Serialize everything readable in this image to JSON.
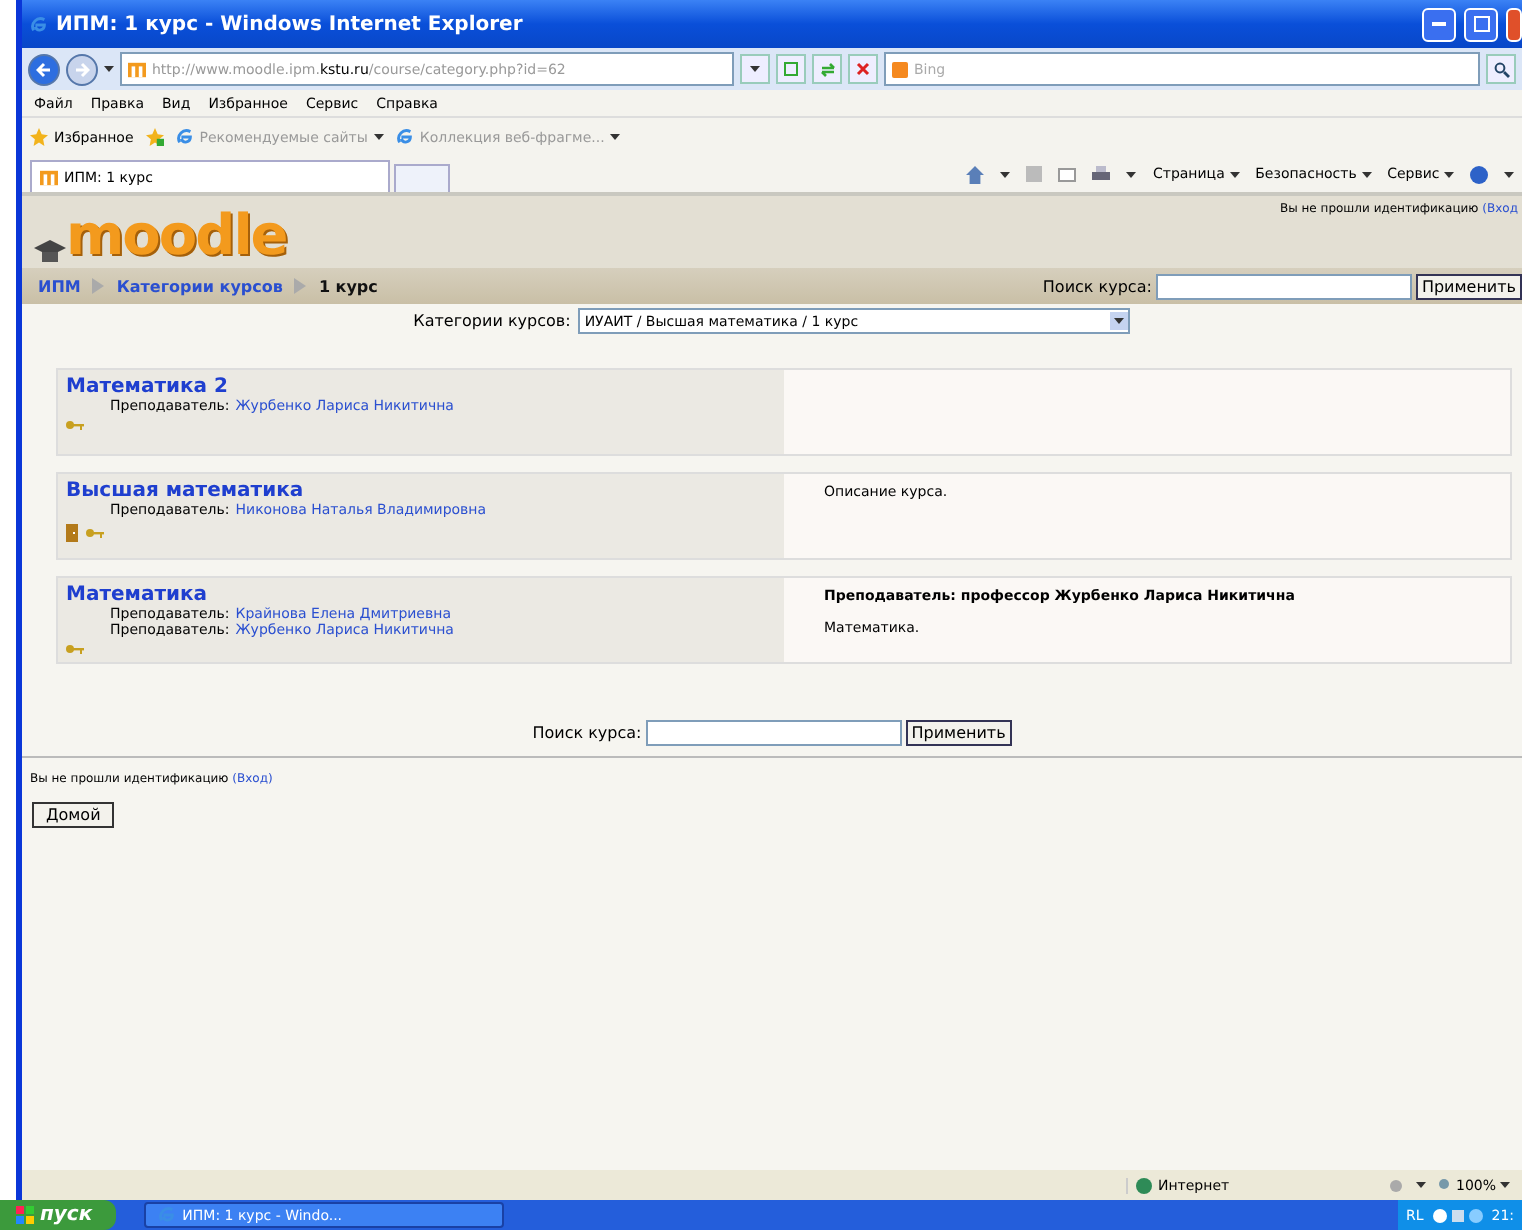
{
  "window": {
    "title": "ИПМ: 1 курс - Windows Internet Explorer"
  },
  "address_bar": {
    "url_prefix": "http://www.moodle.ipm.",
    "url_host": "kstu.ru",
    "url_path": "/course/category.php?id=62",
    "search_placeholder": "Bing"
  },
  "menu": [
    "Файл",
    "Правка",
    "Вид",
    "Избранное",
    "Сервис",
    "Справка"
  ],
  "favorites_bar": {
    "label": "Избранное",
    "links": [
      "Рекомендуемые сайты",
      "Коллекция веб-фрагме..."
    ]
  },
  "tab": {
    "title": "ИПМ: 1 курс"
  },
  "command_bar": [
    "Страница",
    "Безопасность",
    "Сервис"
  ],
  "page": {
    "logo": "moodle",
    "login_notice": {
      "text": "Вы не прошли идентификацию",
      "link": "(Вход"
    },
    "breadcrumb": [
      {
        "label": "ИПМ",
        "current": false
      },
      {
        "label": "Категории курсов",
        "current": false
      },
      {
        "label": "1 курс",
        "current": true
      }
    ],
    "header_search": {
      "label": "Поиск курса:",
      "button": "Применить"
    },
    "category_select": {
      "label": "Категории курсов:",
      "value": "ИУАИТ / Высшая математика / 1 курс"
    },
    "courses": [
      {
        "name": "Математика 2",
        "teachers": [
          {
            "role": "Преподаватель:",
            "name": "Журбенко Лариса Никитична"
          }
        ],
        "guest_access": false,
        "enrolment_key": true
      },
      {
        "name": "Высшая математика",
        "teachers": [
          {
            "role": "Преподаватель:",
            "name": "Никонова Наталья Владимировна"
          }
        ],
        "guest_access": true,
        "enrolment_key": true,
        "description": [
          {
            "text": "Описание курса.",
            "bold": false
          }
        ]
      },
      {
        "name": "Математика",
        "teachers": [
          {
            "role": "Преподаватель:",
            "name": "Крайнова Елена Дмитриевна"
          },
          {
            "role": "Преподаватель:",
            "name": "Журбенко Лариса Никитична"
          }
        ],
        "guest_access": false,
        "enrolment_key": true,
        "description": [
          {
            "text": "Преподаватель: профессор Журбенко Лариса Никитична",
            "bold": true
          },
          {
            "text": "Математика.",
            "bold": false
          }
        ]
      }
    ],
    "footer_search": {
      "label": "Поиск курса:",
      "button": "Применить"
    },
    "footer_login_notice": {
      "text": "Вы не прошли идентификацию",
      "link": "(Вход)"
    },
    "home_button": "Домой"
  },
  "status_bar": {
    "zone": "Интернет",
    "zoom": "100%"
  },
  "taskbar": {
    "start": "пуск",
    "task": "ИПМ: 1 курс - Windo...",
    "language": "RL",
    "clock": "21:"
  }
}
